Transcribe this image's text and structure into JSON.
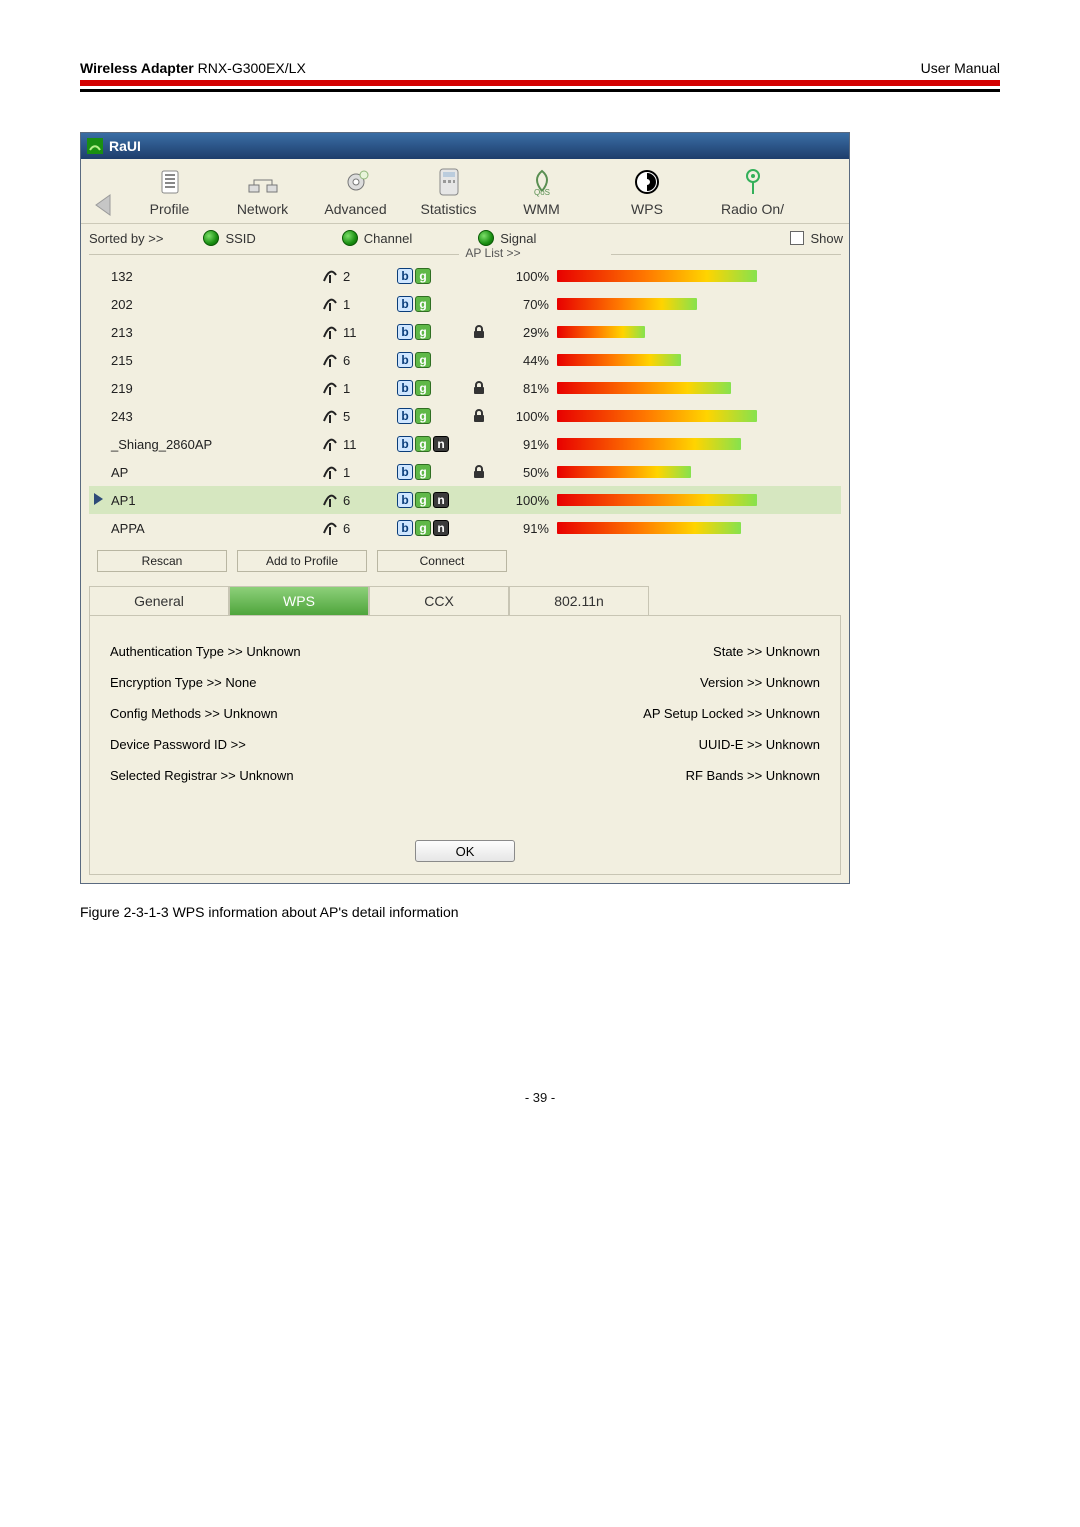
{
  "doc_header": {
    "title": "Wireless Adapter",
    "model": "RNX-G300EX/LX",
    "right": "User Manual"
  },
  "window": {
    "title": "RaUI"
  },
  "toolbar": {
    "items": [
      {
        "label": "Profile"
      },
      {
        "label": "Network"
      },
      {
        "label": "Advanced"
      },
      {
        "label": "Statistics"
      },
      {
        "label": "WMM"
      },
      {
        "label": "WPS"
      },
      {
        "label": "Radio On/"
      }
    ]
  },
  "sort": {
    "sorted_by": "Sorted by >>",
    "ssid": "SSID",
    "channel": "Channel",
    "signal": "Signal",
    "show": "Show",
    "aplist": "AP List >>"
  },
  "ap_rows": [
    {
      "ssid": "132",
      "channel": "2",
      "modes": [
        "b",
        "g"
      ],
      "enc": false,
      "signal": "100%",
      "bar": 100
    },
    {
      "ssid": "202",
      "channel": "1",
      "modes": [
        "b",
        "g"
      ],
      "enc": false,
      "signal": "70%",
      "bar": 70
    },
    {
      "ssid": "213",
      "channel": "11",
      "modes": [
        "b",
        "g"
      ],
      "enc": true,
      "signal": "29%",
      "bar": 44
    },
    {
      "ssid": "215",
      "channel": "6",
      "modes": [
        "b",
        "g"
      ],
      "enc": false,
      "signal": "44%",
      "bar": 62
    },
    {
      "ssid": "219",
      "channel": "1",
      "modes": [
        "b",
        "g"
      ],
      "enc": true,
      "signal": "81%",
      "bar": 87
    },
    {
      "ssid": "243",
      "channel": "5",
      "modes": [
        "b",
        "g"
      ],
      "enc": true,
      "signal": "100%",
      "bar": 100
    },
    {
      "ssid": "_Shiang_2860AP",
      "channel": "11",
      "modes": [
        "b",
        "g",
        "n"
      ],
      "enc": false,
      "signal": "91%",
      "bar": 92
    },
    {
      "ssid": "AP",
      "channel": "1",
      "modes": [
        "b",
        "g"
      ],
      "enc": true,
      "signal": "50%",
      "bar": 67
    },
    {
      "ssid": "AP1",
      "channel": "6",
      "modes": [
        "b",
        "g",
        "n"
      ],
      "enc": false,
      "signal": "100%",
      "bar": 100,
      "selected": true
    },
    {
      "ssid": "APPA",
      "channel": "6",
      "modes": [
        "b",
        "g",
        "n"
      ],
      "enc": false,
      "signal": "91%",
      "bar": 92
    }
  ],
  "actions": {
    "rescan": "Rescan",
    "add": "Add to Profile",
    "connect": "Connect"
  },
  "tabs": {
    "general": "General",
    "wps": "WPS",
    "ccx": "CCX",
    "n80211": "802.11n"
  },
  "wps_left": [
    "Authentication Type >> Unknown",
    "Encryption Type >> None",
    "Config Methods >> Unknown",
    "Device Password ID >>",
    "Selected Registrar >> Unknown"
  ],
  "wps_right": [
    "State >> Unknown",
    "Version >> Unknown",
    "AP Setup Locked >> Unknown",
    "UUID-E >> Unknown",
    "RF Bands >> Unknown"
  ],
  "ok": "OK",
  "caption": "Figure 2-3-1-3 WPS information about AP's detail information",
  "page_num": "- 39 -"
}
